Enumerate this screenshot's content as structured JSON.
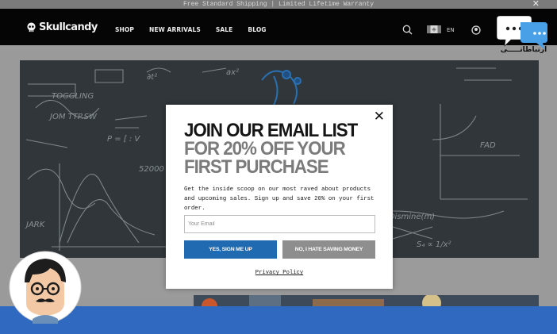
{
  "announcement": {
    "text": "Free Standard Shipping | Limited Lifetime Warranty",
    "close_glyph": "✕"
  },
  "header": {
    "logo_text": "Skullcandy",
    "nav": [
      "SHOP",
      "NEW ARRIVALS",
      "SALE",
      "BLOG"
    ],
    "language": "EN",
    "icons": [
      "search-icon",
      "canada-flag-icon",
      "account-icon"
    ]
  },
  "modal": {
    "close_glyph": "✕",
    "title_line1": "JOIN OUR EMAIL LIST",
    "title_line2": "FOR 20% OFF YOUR",
    "title_line3": "FIRST PURCHASE",
    "body": "Get the inside scoop on our most raved about products and upcoming sales. Sign up and save 20% on your first order.",
    "email_placeholder": "Your Email",
    "email_value": "",
    "accept_label": "YES, SIGN ME UP",
    "decline_label": "NO, I HATE SAVING MONEY",
    "privacy_label": "Privacy Policy"
  },
  "watermark": {
    "chat_label": "ارتباطاتـــــی"
  },
  "colors": {
    "accent": "#1f6ab0",
    "decline": "#8e8e8e",
    "nav_bg": "#050505",
    "bottom_strip": "#2f6ac0"
  }
}
